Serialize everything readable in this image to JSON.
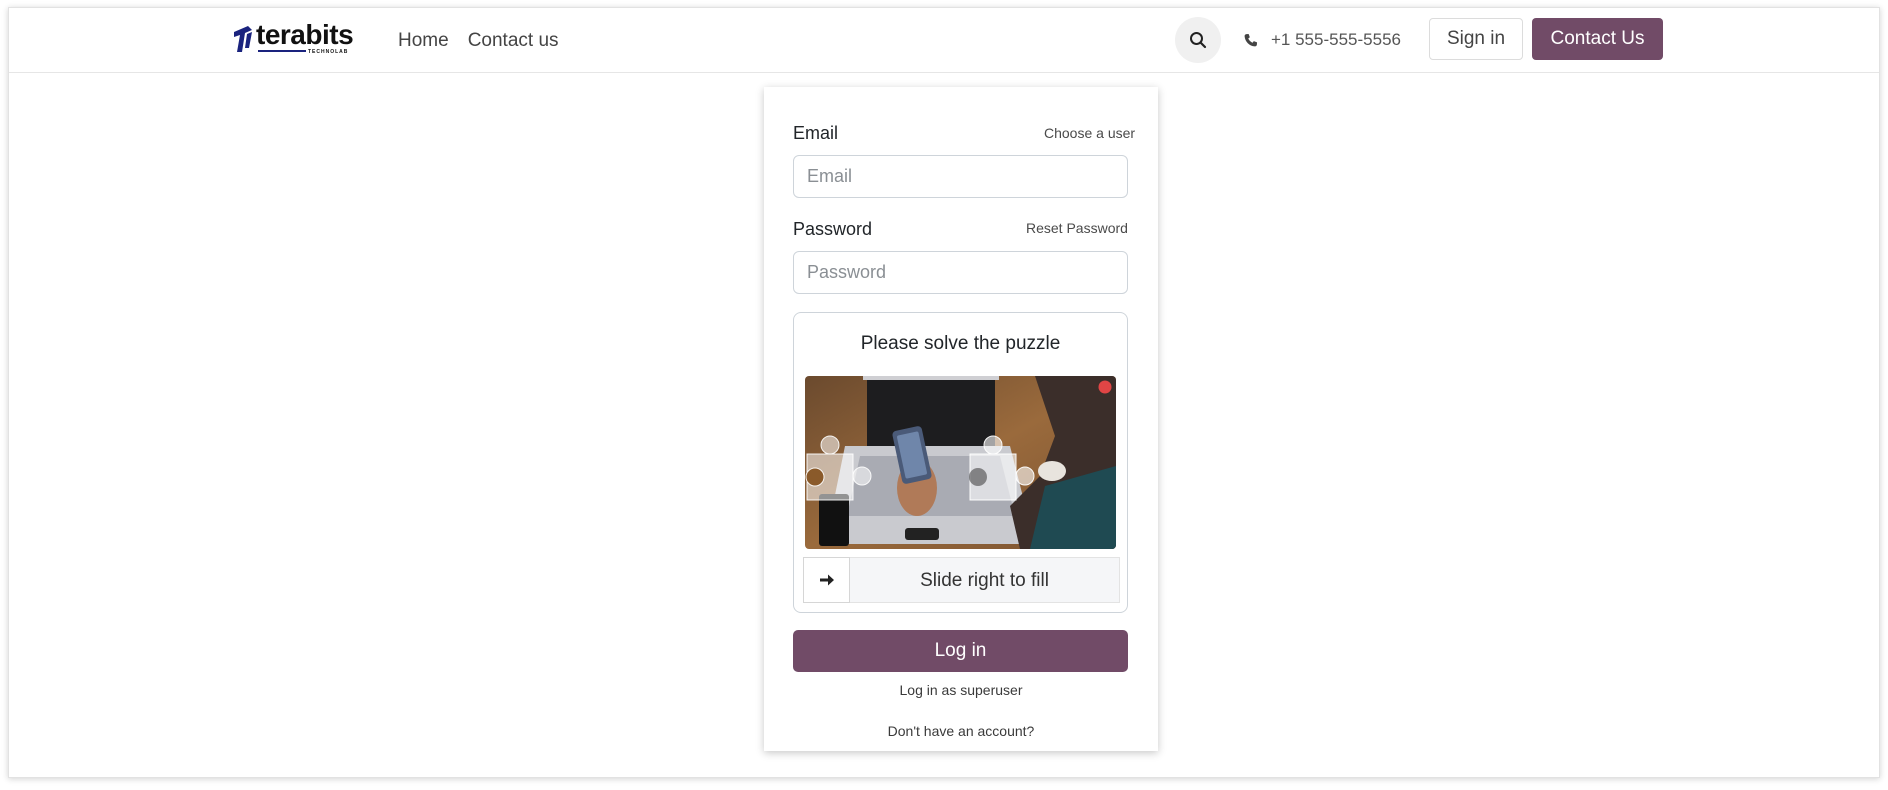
{
  "header": {
    "logo_text": "terabits",
    "logo_sub": "TECHNOLAB",
    "nav": [
      {
        "label": "Home"
      },
      {
        "label": "Contact us"
      }
    ],
    "search_icon": "search-icon",
    "phone_icon": "phone-icon",
    "phone": "+1 555-555-5556",
    "signin_label": "Sign in",
    "contact_label": "Contact Us"
  },
  "login": {
    "email_label": "Email",
    "choose_user": "Choose a user",
    "email_placeholder": "Email",
    "password_label": "Password",
    "reset_password": "Reset Password",
    "password_placeholder": "Password",
    "puzzle_title": "Please solve the puzzle",
    "slider_text": "Slide right to fill",
    "slider_icon": "arrow-right-icon",
    "login_label": "Log in",
    "superuser_link": "Log in as superuser",
    "signup_link": "Don't have an account?"
  },
  "colors": {
    "brand": "#714b67",
    "status_dot": "#e04545"
  }
}
